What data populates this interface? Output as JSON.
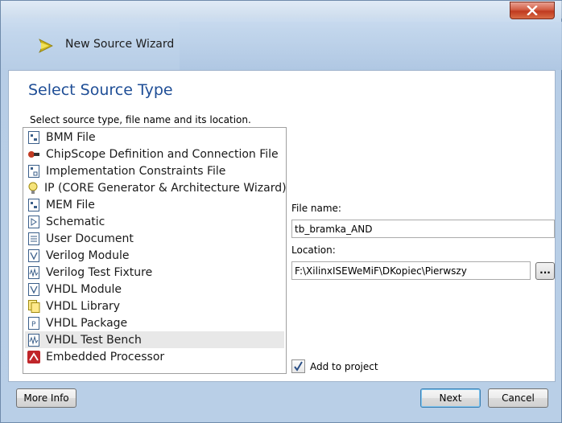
{
  "window": {
    "title": "New Source Wizard"
  },
  "page": {
    "heading": "Select Source Type",
    "instruction": "Select source type, file name and its location."
  },
  "source_types": [
    {
      "label": "BMM File",
      "icon": "bmm-file-icon",
      "selected": false
    },
    {
      "label": "ChipScope Definition and Connection File",
      "icon": "chipscope-icon",
      "selected": false
    },
    {
      "label": "Implementation Constraints File",
      "icon": "constraints-file-icon",
      "selected": false
    },
    {
      "label": "IP (CORE Generator & Architecture Wizard)",
      "icon": "ip-core-icon",
      "selected": false
    },
    {
      "label": "MEM File",
      "icon": "mem-file-icon",
      "selected": false
    },
    {
      "label": "Schematic",
      "icon": "schematic-icon",
      "selected": false
    },
    {
      "label": "User Document",
      "icon": "document-icon",
      "selected": false
    },
    {
      "label": "Verilog Module",
      "icon": "verilog-module-icon",
      "selected": false
    },
    {
      "label": "Verilog Test Fixture",
      "icon": "verilog-test-fixture-icon",
      "selected": false
    },
    {
      "label": "VHDL Module",
      "icon": "vhdl-module-icon",
      "selected": false
    },
    {
      "label": "VHDL Library",
      "icon": "vhdl-library-icon",
      "selected": false
    },
    {
      "label": "VHDL Package",
      "icon": "vhdl-package-icon",
      "selected": false
    },
    {
      "label": "VHDL Test Bench",
      "icon": "vhdl-test-bench-icon",
      "selected": true
    },
    {
      "label": "Embedded Processor",
      "icon": "embedded-processor-icon",
      "selected": false
    }
  ],
  "file_name": {
    "label": "File name:",
    "value": "tb_bramka_AND"
  },
  "location": {
    "label": "Location:",
    "value": "F:\\XilinxISEWeMiF\\DKopiec\\Pierwszy",
    "browse_label": "..."
  },
  "add_to_project": {
    "label": "Add to project",
    "checked": true
  },
  "buttons": {
    "more_info": "More Info",
    "next": "Next",
    "cancel": "Cancel"
  },
  "colors": {
    "heading": "#1f4e96",
    "close_button": "#c03a1f",
    "selected_row": "#e8e8e8"
  }
}
